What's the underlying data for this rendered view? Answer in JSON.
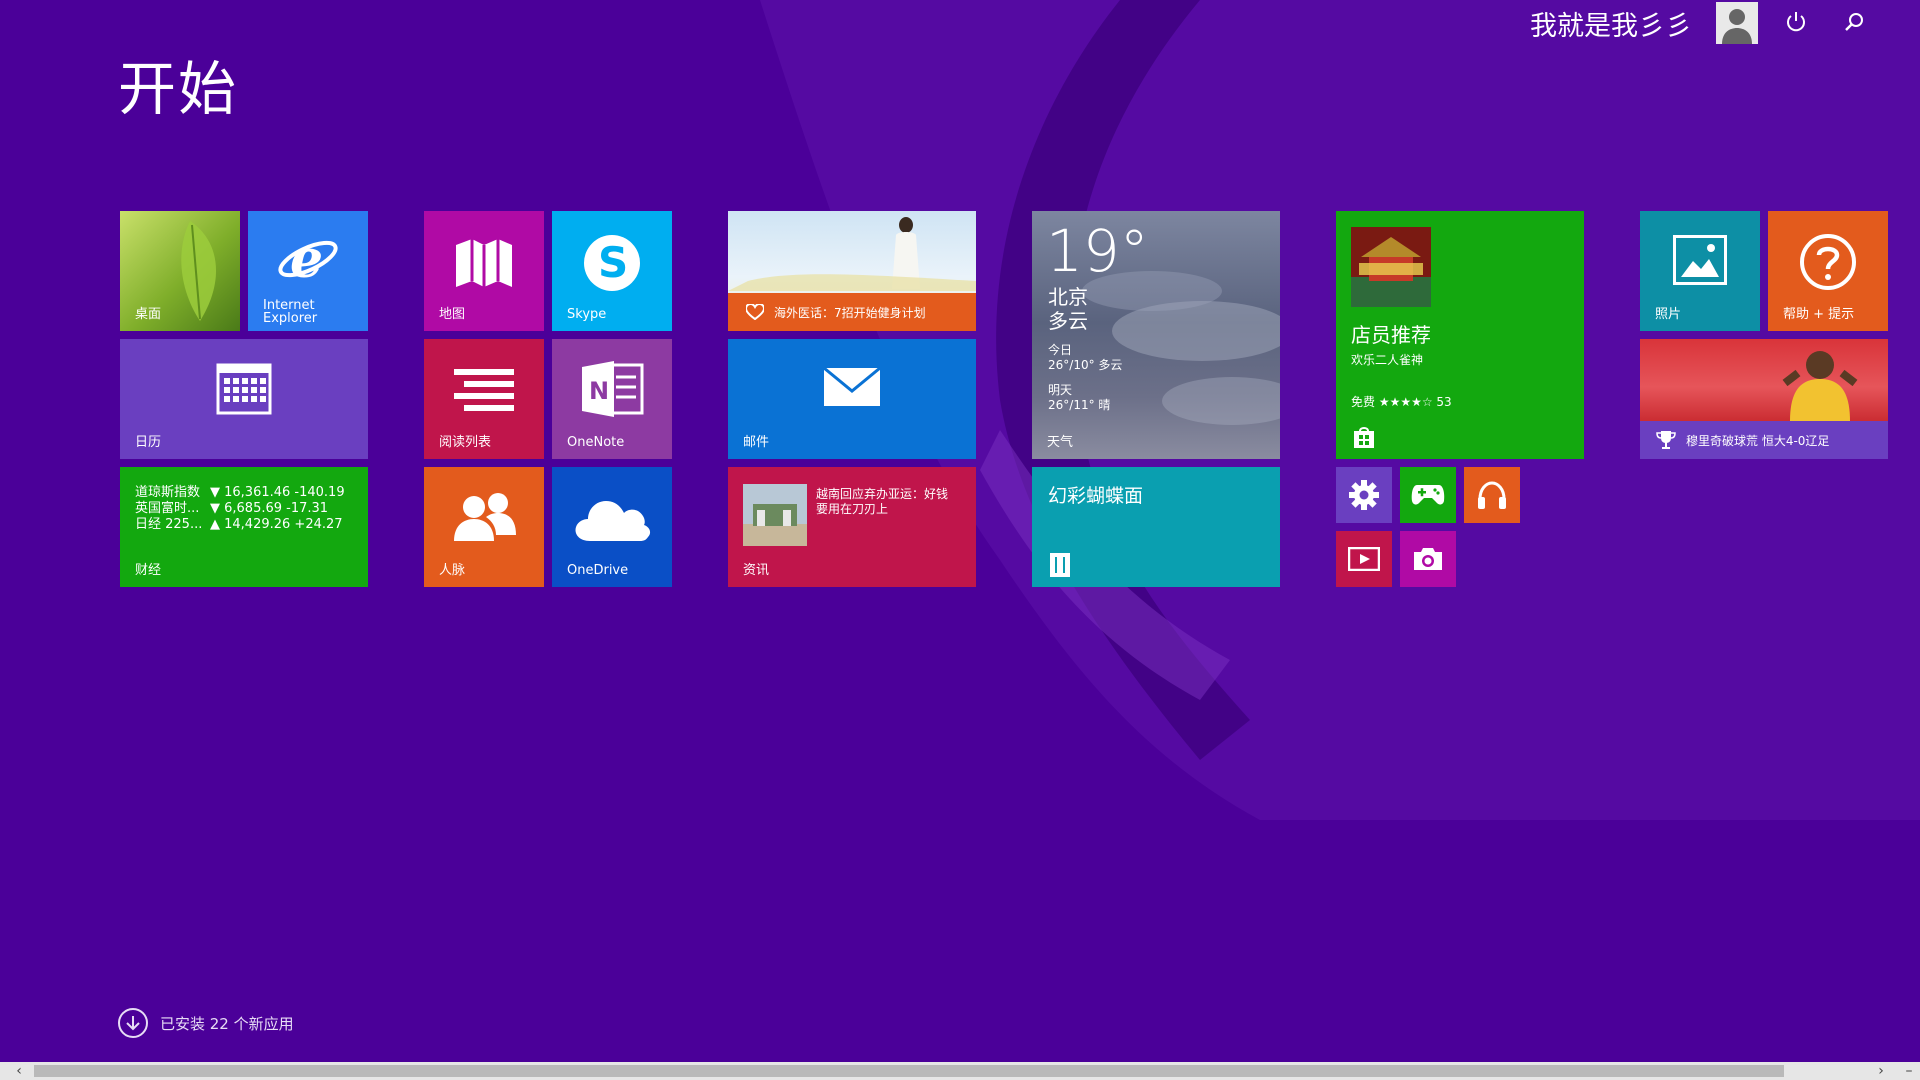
{
  "start": {
    "title": "开始"
  },
  "user": {
    "name": "我就是我彡彡"
  },
  "tiles": {
    "desktop": {
      "label": "桌面",
      "color": "#9cc82a"
    },
    "ie": {
      "label_line1": "Internet",
      "label_line2": "Explorer",
      "color": "#2b7cf0"
    },
    "calendar": {
      "label": "日历",
      "color": "#6a3fc0"
    },
    "finance": {
      "label": "财经",
      "color": "#13a80f",
      "rows": [
        {
          "name": "道琼斯指数",
          "value": "▼ 16,361.46 -140.19"
        },
        {
          "name": "英国富时...",
          "value": "▼ 6,685.69 -17.31"
        },
        {
          "name": "日经 225...",
          "value": "▲ 14,429.26 +24.27"
        }
      ]
    },
    "maps": {
      "label": "地图",
      "color": "#b00aa5"
    },
    "skype": {
      "label": "Skype",
      "color": "#00aef0"
    },
    "reading": {
      "label": "阅读列表",
      "color": "#c0154b"
    },
    "onenote": {
      "label": "OneNote",
      "color": "#8d3aa2"
    },
    "people": {
      "label": "人脉",
      "color": "#e35b1d"
    },
    "onedrive": {
      "label": "OneDrive",
      "color": "#0a4fc6"
    },
    "health": {
      "caption": "海外医话：7招开始健身计划",
      "color": "#e35b1d"
    },
    "mail": {
      "label": "邮件",
      "color": "#0a72d4"
    },
    "news": {
      "caption": "越南回应弃办亚运：好钱要用在刀刃上",
      "label": "资讯",
      "color": "#c0154b"
    },
    "weather": {
      "temp": "19°",
      "city": "北京",
      "condition": "多云",
      "today_label": "今日",
      "today": "26°/10° 多云",
      "tomorrow_label": "明天",
      "tomorrow": "26°/11° 晴",
      "label": "天气"
    },
    "butterfly": {
      "title": "幻彩蝴蝶面",
      "color": "#0a9fb0"
    },
    "store": {
      "title": "店员推荐",
      "subtitle": "欢乐二人雀神",
      "rating": "免费 ★★★★☆ 53",
      "color": "#13a80f"
    },
    "photos": {
      "label": "照片",
      "color": "#0d8fa5"
    },
    "help": {
      "label": "帮助 + 提示",
      "color": "#e35b1d"
    },
    "sports": {
      "caption": "穆里奇破球荒 恒大4-0辽足",
      "color": "#6a3fc0"
    },
    "small": [
      {
        "name": "settings",
        "color": "#6a3fc0"
      },
      {
        "name": "games",
        "color": "#13a80f"
      },
      {
        "name": "music",
        "color": "#e35b1d"
      },
      {
        "name": "video",
        "color": "#c0154b"
      },
      {
        "name": "camera",
        "color": "#b00aa5"
      }
    ]
  },
  "footer": {
    "installed": "已安装 22 个新应用"
  }
}
